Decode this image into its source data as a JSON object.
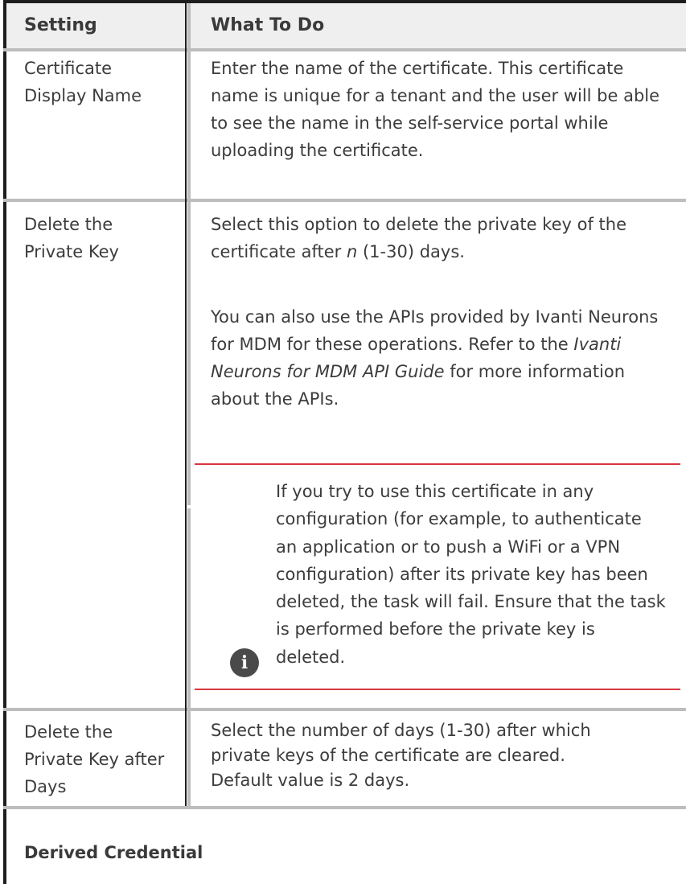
{
  "table": {
    "headers": {
      "setting": "Setting",
      "what_to_do": "What To Do"
    },
    "rows": [
      {
        "setting": "Certificate Display Name",
        "text": "Enter the name of the certificate. This certificate name is unique for a tenant and the user will be able to see the name in the self-service portal while uploading the certificate."
      },
      {
        "setting": "Delete the Private Key",
        "text_before_n": "Select this option to delete the private key of the certificate after ",
        "n": "n",
        "text_after_n": " (1-30) days.",
        "para2_before": "You can also use the APIs provided by Ivanti Neurons for MDM for these operations. Refer to the ",
        "para2_guide": "Ivanti Neurons for MDM API Guide",
        "para2_after": " for more information about the APIs.",
        "note": {
          "icon": "info-icon",
          "text": "If you try to use this certificate in any configuration (for example, to authenticate an application or to push a WiFi or a VPN configuration) after its private key has been deleted, the task will fail. Ensure that the task is performed before the private key is deleted."
        }
      },
      {
        "setting": "Delete the Private Key after Days",
        "lines": [
          "Select the number of days (1-30) after which",
          "private keys of the certificate are cleared.",
          "Default value is 2 days."
        ]
      }
    ],
    "section_title": "Derived Credential"
  }
}
